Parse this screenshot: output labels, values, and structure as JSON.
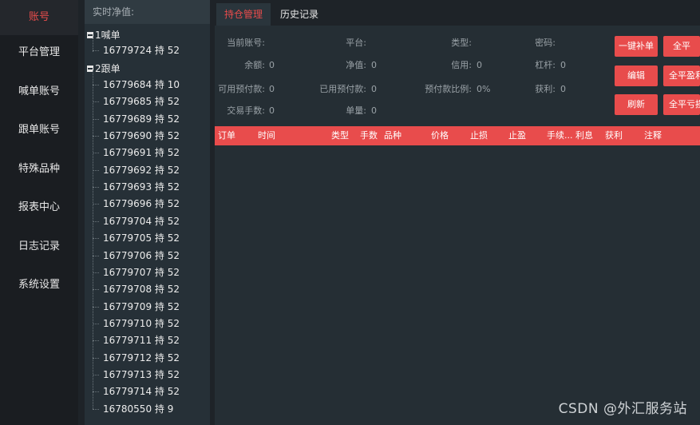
{
  "nav": {
    "items": [
      {
        "label": "账号"
      },
      {
        "label": "平台管理"
      },
      {
        "label": "喊单账号"
      },
      {
        "label": "跟单账号"
      },
      {
        "label": "特殊品种"
      },
      {
        "label": "报表中心"
      },
      {
        "label": "日志记录"
      },
      {
        "label": "系统设置"
      }
    ]
  },
  "tree": {
    "header": "实时净值:",
    "groups": [
      {
        "label": "1喊单",
        "items": [
          "16779724 持 52"
        ]
      },
      {
        "label": "2跟单",
        "items": [
          "16779684 持 10",
          "16779685 持 52",
          "16779689 持 52",
          "16779690 持 52",
          "16779691 持 52",
          "16779692 持 52",
          "16779693 持 52",
          "16779696 持 52",
          "16779704 持 52",
          "16779705 持 52",
          "16779706 持 52",
          "16779707 持 52",
          "16779708 持 52",
          "16779709 持 52",
          "16779710 持 52",
          "16779711 持 52",
          "16779712 持 52",
          "16779713 持 52",
          "16779714 持 52",
          "16780550 持 9"
        ]
      }
    ]
  },
  "tabs": {
    "positions": "持仓管理",
    "history": "历史记录"
  },
  "info": {
    "current_account_label": "当前账号:",
    "platform_label": "平台:",
    "type_label": "类型:",
    "password_label": "密码:",
    "balance_label": "余额:",
    "balance_value": "0",
    "equity_label": "净值:",
    "equity_value": "0",
    "credit_label": "信用:",
    "credit_value": "0",
    "leverage_label": "杠杆:",
    "leverage_value": "0",
    "free_margin_label": "可用预付款:",
    "free_margin_value": "0",
    "used_margin_label": "已用预付款:",
    "used_margin_value": "0",
    "margin_ratio_label": "预付款比例:",
    "margin_ratio_value": "0%",
    "profit_label": "获利:",
    "profit_value": "0",
    "lots_label": "交易手数:",
    "lots_value": "0",
    "orders_label": "单量:",
    "orders_value": "0"
  },
  "buttons": {
    "one_click_fill": "一键补单",
    "close_all": "全平",
    "edit": "编辑",
    "close_all_profit": "全平盈利",
    "refresh": "刷新",
    "close_all_loss": "全平亏损"
  },
  "grid": {
    "columns": [
      "订单",
      "时间",
      "类型",
      "手数",
      "品种",
      "价格",
      "止损",
      "止盈",
      "手续...",
      "利息",
      "获利",
      "注释"
    ]
  },
  "watermark": "CSDN @外汇服务站",
  "colors": {
    "accent": "#e84c4c",
    "nav_bg": "#1a1d21",
    "panel_bg": "#263037",
    "main_bg": "#252e34"
  }
}
